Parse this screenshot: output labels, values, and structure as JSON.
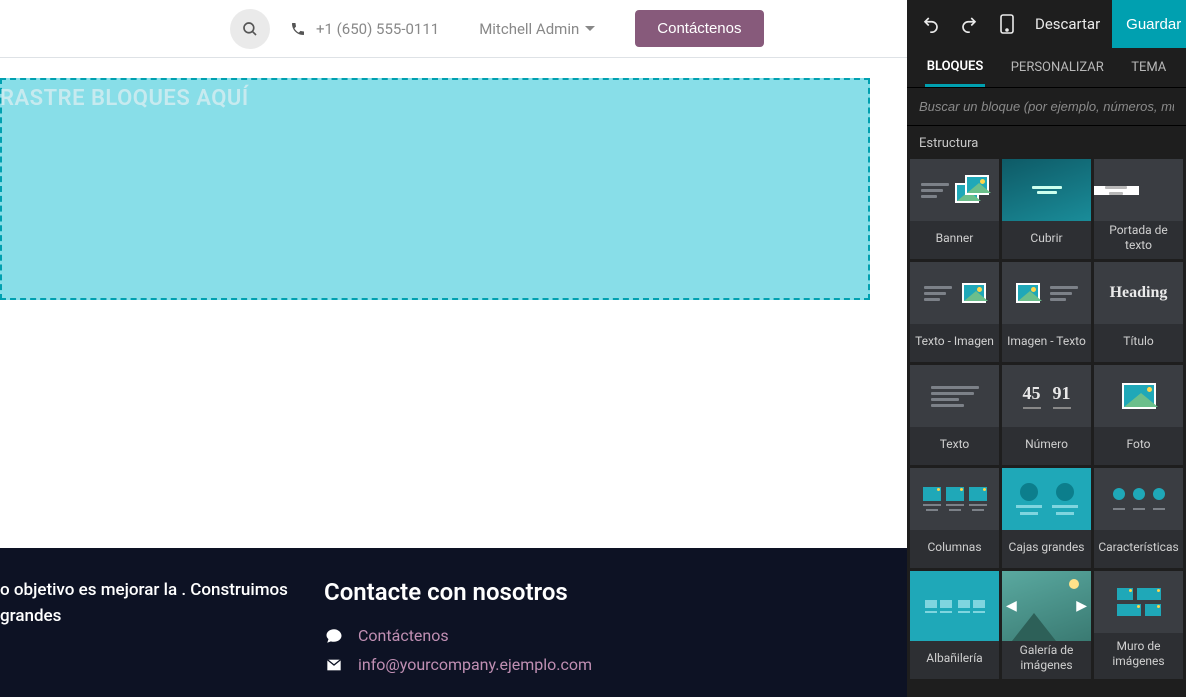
{
  "topbar": {
    "phone": "+1 (650) 555-0111",
    "user": "Mitchell Admin",
    "contact_btn": "Contáctenos"
  },
  "dropzone": {
    "label": "RASTRE BLOQUES AQUÍ"
  },
  "footer": {
    "about": "o objetivo es mejorar la . Construimos grandes",
    "heading": "Contacte con nosotros",
    "contact_link": "Contáctenos",
    "email": "info@yourcompany.ejemplo.com"
  },
  "sidebar": {
    "discard": "Descartar",
    "save": "Guardar",
    "tabs": {
      "blocks": "BLOQUES",
      "custom": "PERSONALIZAR",
      "theme": "TEMA"
    },
    "search_placeholder": "Buscar un bloque (por ejemplo, números, muro de",
    "section": "Estructura",
    "blocks": [
      {
        "label": "Banner"
      },
      {
        "label": "Cubrir"
      },
      {
        "label": "Portada de texto"
      },
      {
        "label": "Texto - Imagen"
      },
      {
        "label": "Imagen - Texto"
      },
      {
        "label": "Título",
        "heading": "Heading"
      },
      {
        "label": "Texto"
      },
      {
        "label": "Número",
        "n1": "45",
        "n2": "91"
      },
      {
        "label": "Foto"
      },
      {
        "label": "Columnas"
      },
      {
        "label": "Cajas grandes"
      },
      {
        "label": "Características"
      },
      {
        "label": "Albañilería"
      },
      {
        "label": "Galería de imágenes"
      },
      {
        "label": "Muro de imágenes"
      }
    ]
  }
}
